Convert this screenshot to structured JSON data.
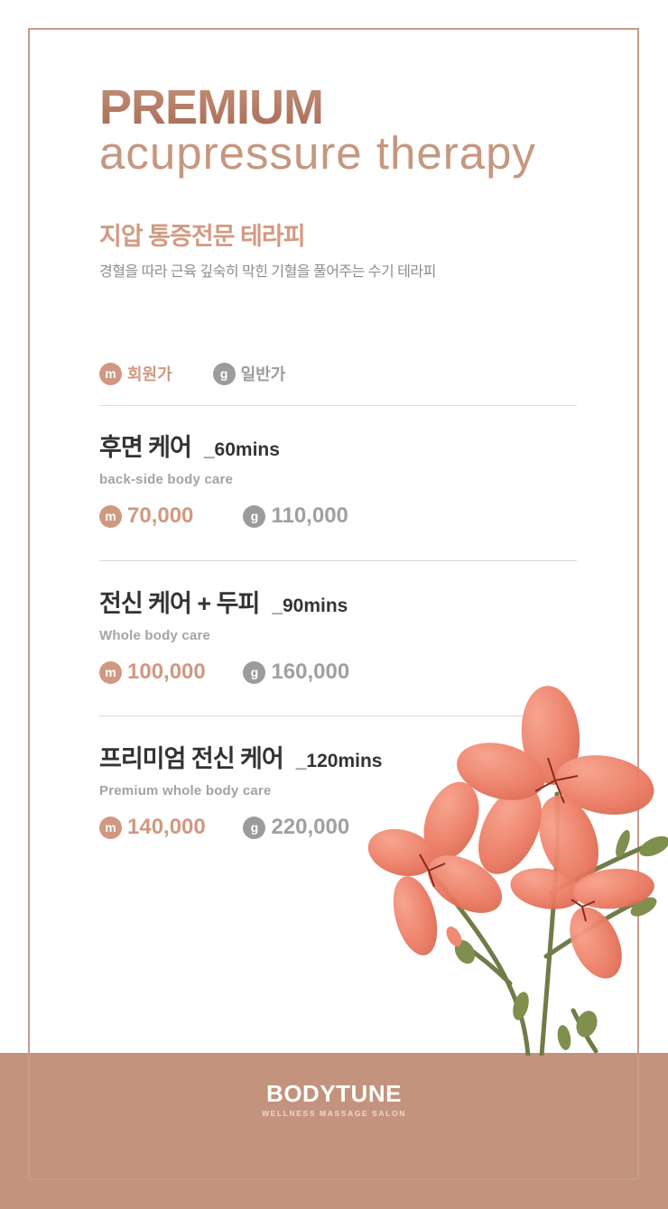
{
  "header": {
    "title": "PREMIUM",
    "subtitle": "acupressure therapy"
  },
  "therapy": {
    "title": "지압 통증전문 테라피",
    "description": "경혈을 따라 근육 깊숙히 막힌 기혈을 풀어주는 수기 테라피"
  },
  "legend": {
    "member": {
      "badge": "m",
      "label": "회원가"
    },
    "general": {
      "badge": "g",
      "label": "일반가"
    }
  },
  "services": [
    {
      "name": "후면 케어",
      "duration": "_60mins",
      "english": "back-side body care",
      "member_price": "70,000",
      "general_price": "110,000"
    },
    {
      "name": "전신 케어 + 두피",
      "duration": "_90mins",
      "english": "Whole body care",
      "member_price": "100,000",
      "general_price": "160,000"
    },
    {
      "name": "프리미엄 전신 케어",
      "duration": "_120mins",
      "english": "Premium whole body care",
      "member_price": "140,000",
      "general_price": "220,000"
    }
  ],
  "brand": {
    "name": "BODYTUNE",
    "tagline": "WELLNESS MASSAGE SALON"
  },
  "colors": {
    "accent": "#d19880",
    "footer": "#c3937d",
    "gray_badge": "#9b9b9b"
  }
}
